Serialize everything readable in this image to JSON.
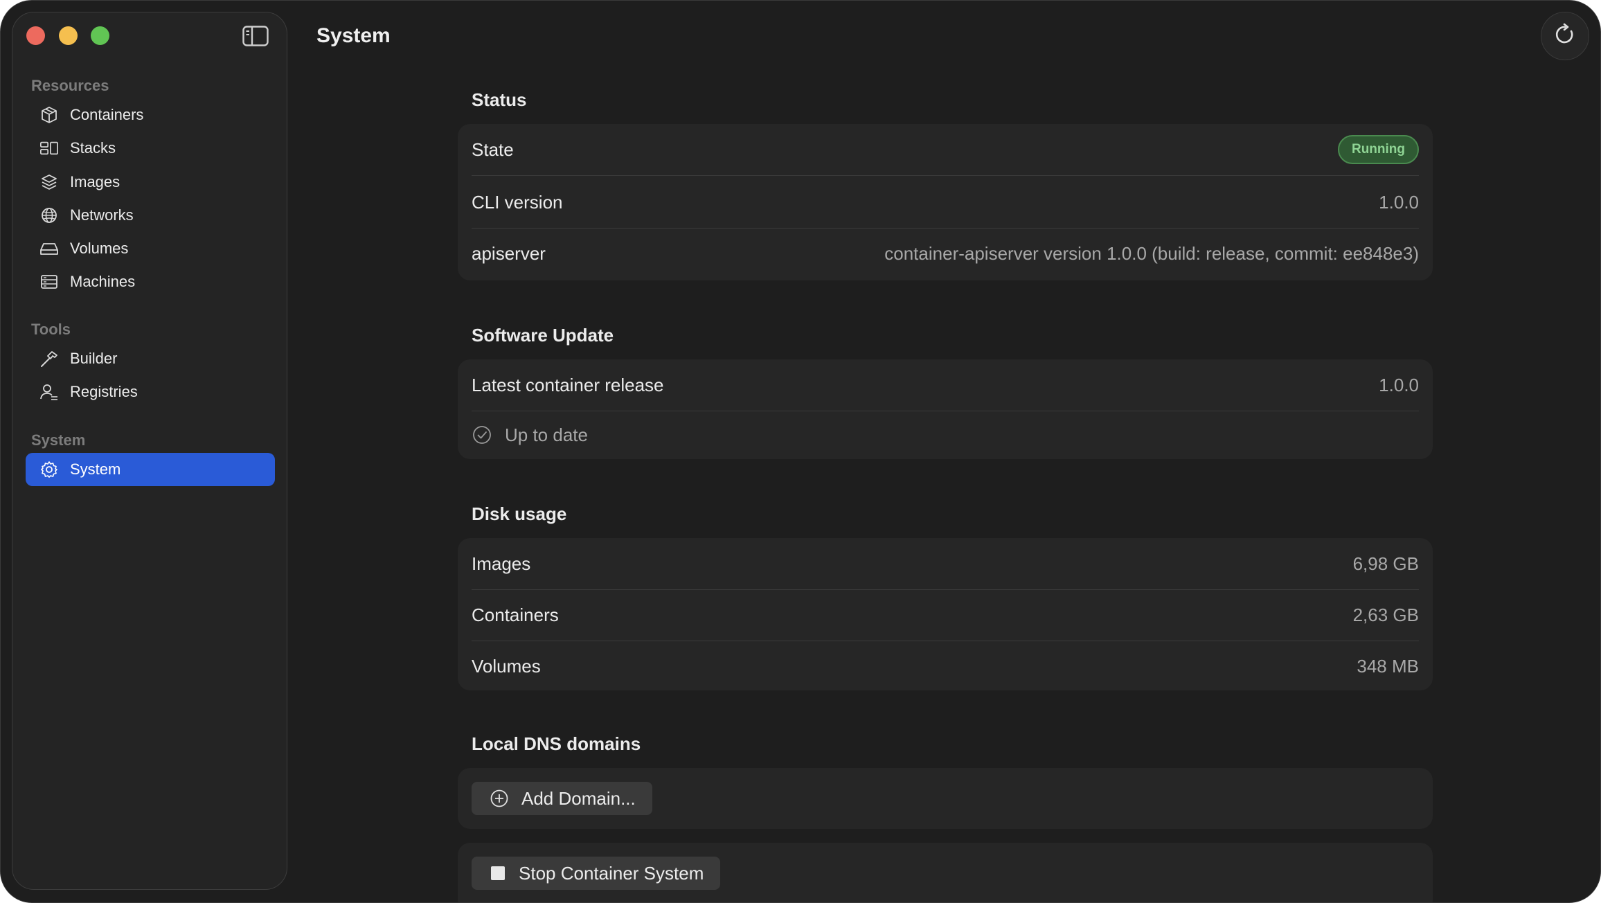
{
  "window": {
    "title": "System"
  },
  "sidebar": {
    "sections": [
      {
        "label": "Resources",
        "items": [
          {
            "label": "Containers",
            "icon": "cube-icon"
          },
          {
            "label": "Stacks",
            "icon": "stack-icon"
          },
          {
            "label": "Images",
            "icon": "layers-icon"
          },
          {
            "label": "Networks",
            "icon": "globe-icon"
          },
          {
            "label": "Volumes",
            "icon": "drive-icon"
          },
          {
            "label": "Machines",
            "icon": "server-icon"
          }
        ]
      },
      {
        "label": "Tools",
        "items": [
          {
            "label": "Builder",
            "icon": "hammer-icon"
          },
          {
            "label": "Registries",
            "icon": "person-icon"
          }
        ]
      },
      {
        "label": "System",
        "items": [
          {
            "label": "System",
            "icon": "gear-icon",
            "selected": true
          }
        ]
      }
    ]
  },
  "status": {
    "heading": "Status",
    "state_label": "State",
    "state_value": "Running",
    "cli_label": "CLI version",
    "cli_value": "1.0.0",
    "api_label": "apiserver",
    "api_value": "container-apiserver version 1.0.0 (build: release, commit: ee848e3)"
  },
  "software_update": {
    "heading": "Software Update",
    "latest_label": "Latest container release",
    "latest_value": "1.0.0",
    "status_text": "Up to date"
  },
  "disk_usage": {
    "heading": "Disk usage",
    "rows": [
      {
        "label": "Images",
        "value": "6,98 GB"
      },
      {
        "label": "Containers",
        "value": "2,63 GB"
      },
      {
        "label": "Volumes",
        "value": "348 MB"
      }
    ]
  },
  "dns": {
    "heading": "Local DNS domains",
    "add_button": "Add Domain..."
  },
  "actions": {
    "stop_button": "Stop Container System"
  },
  "colors": {
    "accent": "#2a5bd7",
    "running_badge": "#2f5a33",
    "running_text": "#8fd494"
  }
}
